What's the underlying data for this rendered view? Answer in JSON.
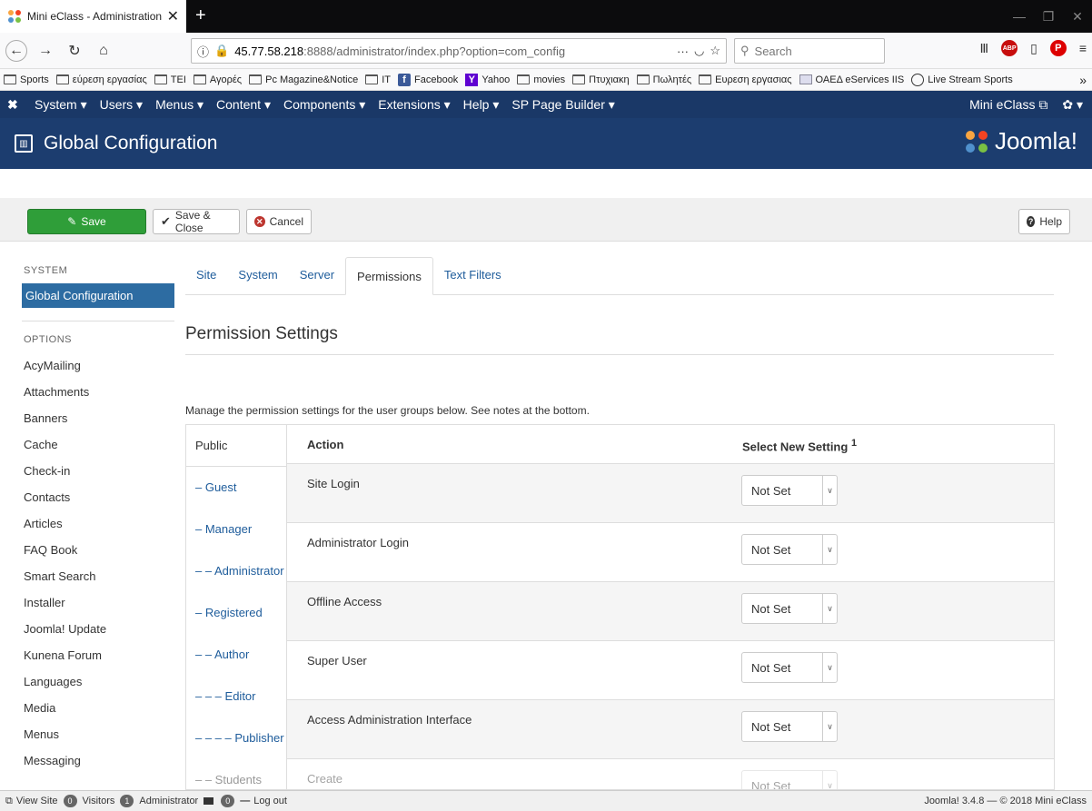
{
  "browser": {
    "tab_title": "Mini eClass - Administration - ",
    "url_host": "45.77.58.218",
    "url_rest": ":8888/administrator/index.php?option=com_config",
    "search_placeholder": "Search",
    "bookmarks": [
      "Sports",
      "εύρεση εργασίας",
      "TEI",
      "Αγορές",
      "Pc Magazine&Notice",
      "IT",
      "Facebook",
      "Yahoo",
      "movies",
      "Πτυχιακη",
      "Πωλητές",
      "Ευρεση εργασιας",
      "ΟΑΕΔ eServices IIS",
      "Live Stream Sports"
    ]
  },
  "topmenu": {
    "items": [
      "System ▾",
      "Users ▾",
      "Menus ▾",
      "Content ▾",
      "Components ▾",
      "Extensions ▾",
      "Help ▾",
      "SP Page Builder ▾"
    ],
    "site_link": "Mini eClass",
    "settings_caret": "▾"
  },
  "header": {
    "title": "Global Configuration",
    "brand": "Joomla!"
  },
  "toolbar": {
    "save": "Save",
    "save_close": "Save & Close",
    "cancel": "Cancel",
    "help": "Help"
  },
  "sidebar": {
    "system_head": "SYSTEM",
    "active_item": "Global Configuration",
    "options_head": "OPTIONS",
    "items": [
      "AcyMailing",
      "Attachments",
      "Banners",
      "Cache",
      "Check-in",
      "Contacts",
      "Articles",
      "FAQ Book",
      "Smart Search",
      "Installer",
      "Joomla! Update",
      "Kunena Forum",
      "Languages",
      "Media",
      "Menus",
      "Messaging"
    ]
  },
  "main": {
    "tabs": [
      "Site",
      "System",
      "Server",
      "Permissions",
      "Text Filters"
    ],
    "active_tab": "Permissions",
    "title": "Permission Settings",
    "description": "Manage the permission settings for the user groups below. See notes at the bottom.",
    "groups": [
      "Public",
      "– Guest",
      "– Manager",
      "– – Administrator",
      "– Registered",
      "– – Author",
      "– – – Editor",
      "– – – – Publisher",
      "– – Students"
    ],
    "col_action": "Action",
    "col_setting": "Select New Setting",
    "col_setting_sup": "1",
    "rows": [
      {
        "action": "Site Login",
        "setting": "Not Set"
      },
      {
        "action": "Administrator Login",
        "setting": "Not Set"
      },
      {
        "action": "Offline Access",
        "setting": "Not Set"
      },
      {
        "action": "Super User",
        "setting": "Not Set"
      },
      {
        "action": "Access Administration Interface",
        "setting": "Not Set"
      },
      {
        "action": "Create",
        "setting": "Not Set"
      }
    ]
  },
  "statusbar": {
    "view_site": "View Site",
    "visitors_count": "0",
    "visitors": "Visitors",
    "admin_count": "1",
    "administrator": "Administrator",
    "messages_count": "0",
    "logout": "Log out",
    "version": "Joomla! 3.4.8 — © 2018 Mini eClass"
  },
  "colors": {
    "menu_bg": "#1a3867",
    "header_bg": "#1c3d6f",
    "save_green": "#2f9e39",
    "active_blue": "#2d6ca2",
    "link_blue": "#1e5c9b"
  }
}
